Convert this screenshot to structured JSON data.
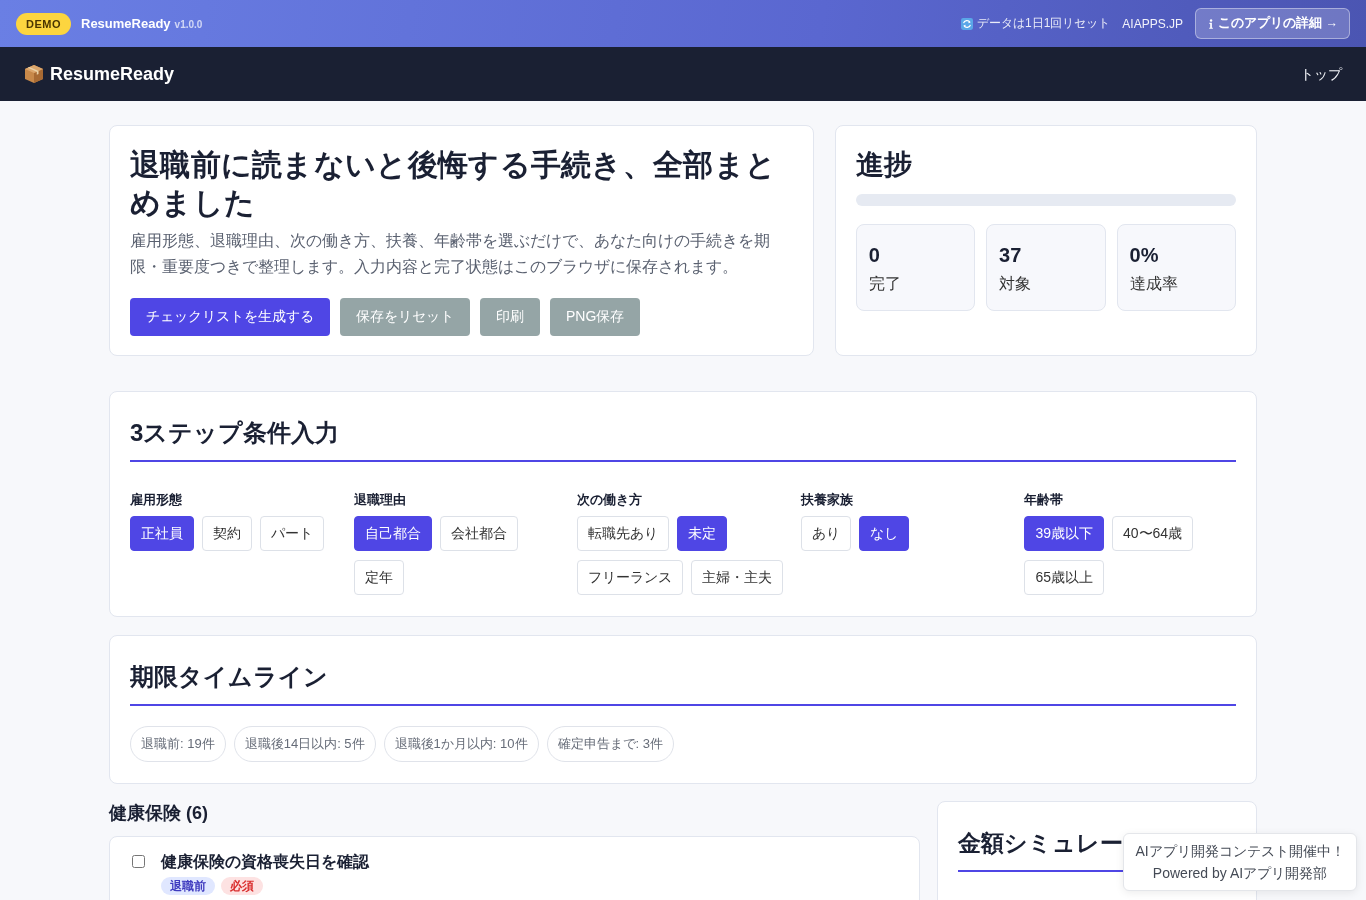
{
  "top_bar": {
    "badge": "DEMO",
    "app_name": "ResumeReady",
    "version": "v1.0.0",
    "reset_note": "データは1日1回リセット",
    "site_link": "AIAPPS.JP",
    "details_button": "このアプリの詳細 →"
  },
  "nav": {
    "brand": "ResumeReady",
    "links": [
      "トップ"
    ]
  },
  "hero": {
    "title": "退職前に読まないと後悔する手続き、全部まとめました",
    "description": "雇用形態、退職理由、次の働き方、扶養、年齢帯を選ぶだけで、あなた向けの手続きを期限・重要度つきで整理します。入力内容と完了状態はこのブラウザに保存されます。",
    "buttons": [
      {
        "label": "チェックリストを生成する",
        "kind": "primary"
      },
      {
        "label": "保存をリセット",
        "kind": "secondary"
      },
      {
        "label": "印刷",
        "kind": "secondary"
      },
      {
        "label": "PNG保存",
        "kind": "secondary"
      }
    ]
  },
  "progress": {
    "title": "進捗",
    "level": 0,
    "stats": [
      {
        "value": "0",
        "label": "完了"
      },
      {
        "value": "37",
        "label": "対象"
      },
      {
        "value": "0%",
        "label": "達成率"
      }
    ]
  },
  "conditions": {
    "title": "3ステップ条件入力",
    "groups": [
      {
        "label": "雇用形態",
        "options": [
          {
            "label": "正社員",
            "selected": true
          },
          {
            "label": "契約",
            "selected": false
          },
          {
            "label": "パート",
            "selected": false
          }
        ]
      },
      {
        "label": "退職理由",
        "options": [
          {
            "label": "自己都合",
            "selected": true
          },
          {
            "label": "会社都合",
            "selected": false
          },
          {
            "label": "定年",
            "selected": false
          }
        ]
      },
      {
        "label": "次の働き方",
        "options": [
          {
            "label": "転職先あり",
            "selected": false
          },
          {
            "label": "未定",
            "selected": true
          },
          {
            "label": "フリーランス",
            "selected": false
          },
          {
            "label": "主婦・主夫",
            "selected": false
          }
        ]
      },
      {
        "label": "扶養家族",
        "options": [
          {
            "label": "あり",
            "selected": false
          },
          {
            "label": "なし",
            "selected": true
          }
        ]
      },
      {
        "label": "年齢帯",
        "options": [
          {
            "label": "39歳以下",
            "selected": true
          },
          {
            "label": "40〜64歳",
            "selected": false
          },
          {
            "label": "65歳以上",
            "selected": false
          }
        ]
      }
    ]
  },
  "timeline": {
    "title": "期限タイムライン",
    "chips": [
      "退職前: 19件",
      "退職後14日以内: 5件",
      "退職後1か月以内: 10件",
      "確定申告まで: 3件"
    ]
  },
  "checklist": {
    "sections": [
      {
        "title": "健康保険 (6)",
        "items": [
          {
            "title": "健康保険の資格喪失日を確認",
            "checked": false,
            "tags": [
              {
                "label": "退職前",
                "kind": "timing"
              },
              {
                "label": "必須",
                "kind": "required"
              }
            ]
          }
        ]
      }
    ]
  },
  "simulator": {
    "title": "金額シミュレー"
  },
  "toast": {
    "lines": [
      "AIアプリ開発コンテスト開催中！",
      "Powered by AIアプリ開発部"
    ]
  }
}
